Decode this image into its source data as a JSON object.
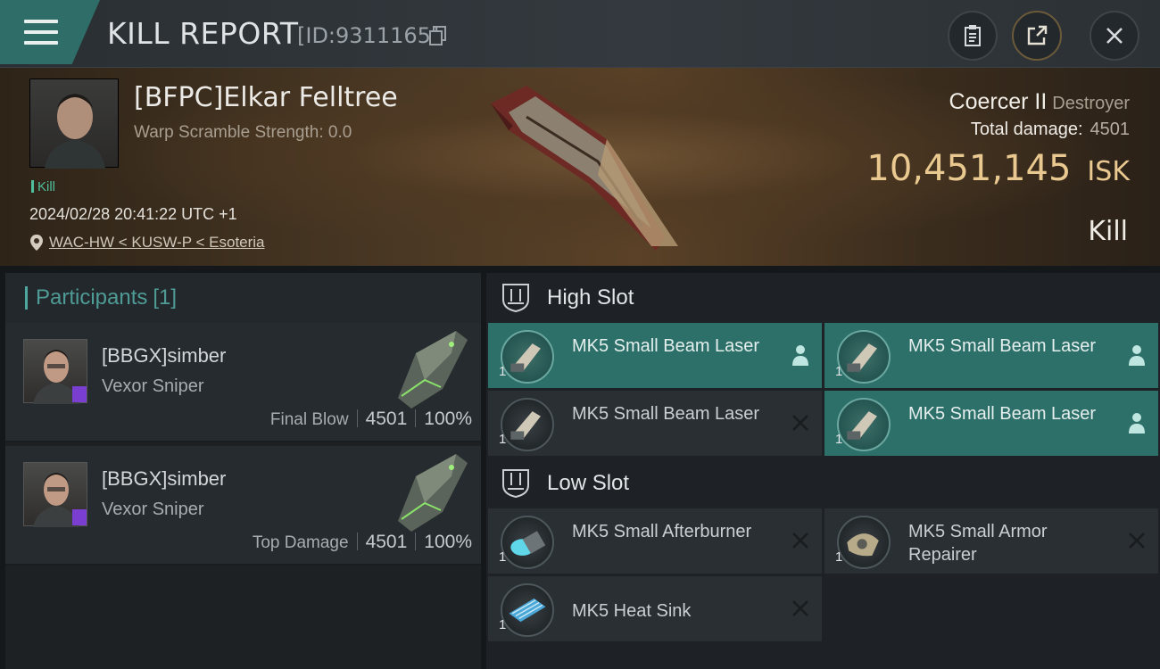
{
  "header": {
    "title": "KILL REPORT",
    "report_id": "[ID:9311165]"
  },
  "victim": {
    "name": "[BFPC]Elkar Felltree",
    "warp_scramble": "Warp Scramble Strength: 0.0",
    "tag": "Kill",
    "timestamp": "2024/02/28 20:41:22 UTC +1",
    "location": "WAC-HW < KUSW-P < Esoteria",
    "ship_name": "Coercer II",
    "ship_class": "Destroyer",
    "total_damage_label": "Total damage:",
    "total_damage": "4501",
    "isk_value": "10,451,145",
    "isk_unit": "ISK",
    "result": "Kill"
  },
  "participants": {
    "title": "Participants",
    "count": "[1]",
    "rows": [
      {
        "name": "[BBGX]simber",
        "ship": "Vexor Sniper",
        "label": "Final Blow",
        "damage": "4501",
        "percent": "100%"
      },
      {
        "name": "[BBGX]simber",
        "ship": "Vexor Sniper",
        "label": "Top Damage",
        "damage": "4501",
        "percent": "100%"
      }
    ]
  },
  "slots": {
    "high": {
      "label": "High Slot",
      "items": [
        {
          "name": "MK5 Small Beam Laser",
          "qty": "1",
          "status": "dropped"
        },
        {
          "name": "MK5 Small Beam Laser",
          "qty": "1",
          "status": "dropped"
        },
        {
          "name": "MK5 Small Beam Laser",
          "qty": "1",
          "status": "destroyed"
        },
        {
          "name": "MK5 Small Beam Laser",
          "qty": "1",
          "status": "dropped"
        }
      ]
    },
    "low": {
      "label": "Low Slot",
      "items": [
        {
          "name": "MK5 Small Afterburner",
          "qty": "1",
          "status": "destroyed"
        },
        {
          "name": "MK5 Small Armor Repairer",
          "qty": "1",
          "status": "destroyed"
        },
        {
          "name": "MK5 Heat Sink",
          "qty": "1",
          "status": "destroyed"
        }
      ]
    }
  },
  "colors": {
    "accent_teal": "#2d6f69",
    "isk_gold": "#e9c98f",
    "panel_dark": "#262b2f"
  },
  "icons": {
    "menu": "hamburger-icon",
    "copy": "copy-icon",
    "clipboard": "clipboard-icon",
    "share": "share-icon",
    "close": "close-icon",
    "location": "location-pin-icon",
    "dropped": "person-icon",
    "destroyed": "x-icon"
  }
}
